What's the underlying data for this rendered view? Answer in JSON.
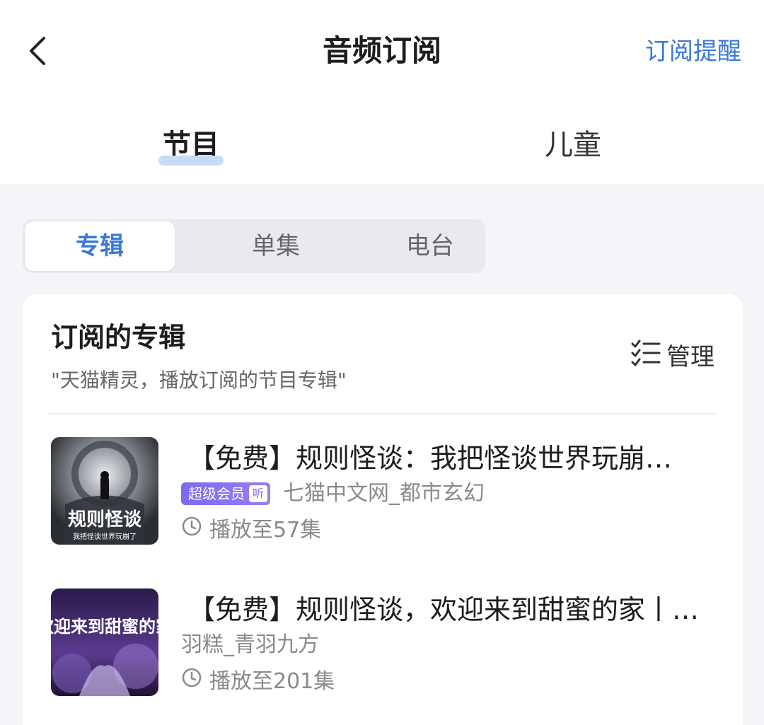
{
  "header": {
    "title": "音频订阅",
    "right_link": "订阅提醒"
  },
  "main_tabs": [
    {
      "label": "节目",
      "active": true
    },
    {
      "label": "儿童",
      "active": false
    }
  ],
  "segments": [
    {
      "label": "专辑",
      "active": true
    },
    {
      "label": "单集",
      "active": false
    },
    {
      "label": "电台",
      "active": false
    }
  ],
  "card": {
    "title": "订阅的专辑",
    "subtitle": "\"天猫精灵，播放订阅的节目专辑\"",
    "manage_label": "管理"
  },
  "albums": [
    {
      "title": "【免费】规则怪谈：我把怪谈世界玩崩…",
      "badge": "超级会员",
      "badge_icon": "听",
      "author": "七猫中文网_都市玄幻",
      "progress": "播放至57集",
      "cover_text": "规则怪谈",
      "cover_subtext": "我把怪谈世界玩崩了"
    },
    {
      "title": "【免费】规则怪谈，欢迎来到甜蜜的家丨…",
      "author": "羽糕_青羽九方",
      "progress": "播放至201集",
      "cover_text": "欢迎来到甜蜜的家"
    }
  ],
  "colors": {
    "accent": "#3a78d8",
    "vip_badge": "#7b6cf0",
    "background": "#f4f5f8"
  }
}
